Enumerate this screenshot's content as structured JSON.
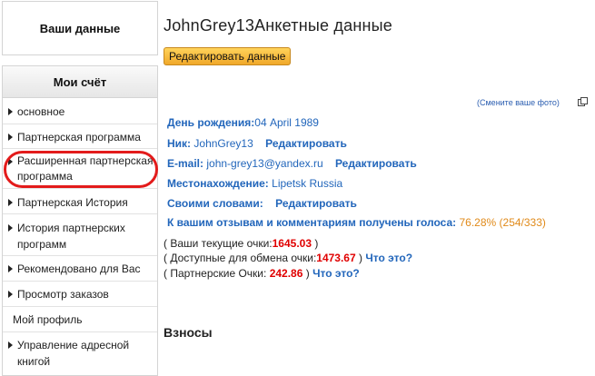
{
  "sidebar": {
    "your_data": "Ваши данные",
    "menu_title": "Мои счёт",
    "items": [
      {
        "label": "основное"
      },
      {
        "label": "Партнерская программа"
      },
      {
        "label": "Расширенная партнерская программа"
      },
      {
        "label": "Партнерская История"
      },
      {
        "label": "История партнерских программ"
      },
      {
        "label": "Рекомендовано для Вас"
      },
      {
        "label": "Просмотр заказов"
      },
      {
        "label": "Мой профиль"
      },
      {
        "label": "Управление адресной книгой"
      }
    ]
  },
  "main": {
    "title": "JohnGrey13Анкетные данные",
    "edit_button": "Редактировать данные",
    "change_photo": "(Смените ваше фото)",
    "birthday": {
      "label": "День рождения:",
      "value": "04 April 1989"
    },
    "nick": {
      "label": "Ник:",
      "value": "JohnGrey13",
      "edit": "Редактировать"
    },
    "email": {
      "label": "E-mail:",
      "value": "john-grey13@yandex.ru",
      "edit": "Редактировать"
    },
    "location": {
      "label": "Местонахождение:",
      "value": "Lipetsk Russia"
    },
    "own_words": {
      "label": "Своими словами:",
      "edit": "Редактировать"
    },
    "votes": {
      "label": "К вашим отзывам и комментариям получены голоса:",
      "value": "76.28% (254/333)"
    },
    "current_points": {
      "prefix": "( Ваши текущие очки:",
      "value": "1645.03",
      "suffix": " )"
    },
    "exchange_points": {
      "prefix": "( Доступные для обмена очки:",
      "value": "1473.67",
      "suffix": " )",
      "link": "Что это?"
    },
    "partner_points": {
      "prefix": "( Партнерские Очки: ",
      "value": "242.86",
      "suffix": " )",
      "link": "Что это?"
    },
    "section": "Взносы"
  }
}
